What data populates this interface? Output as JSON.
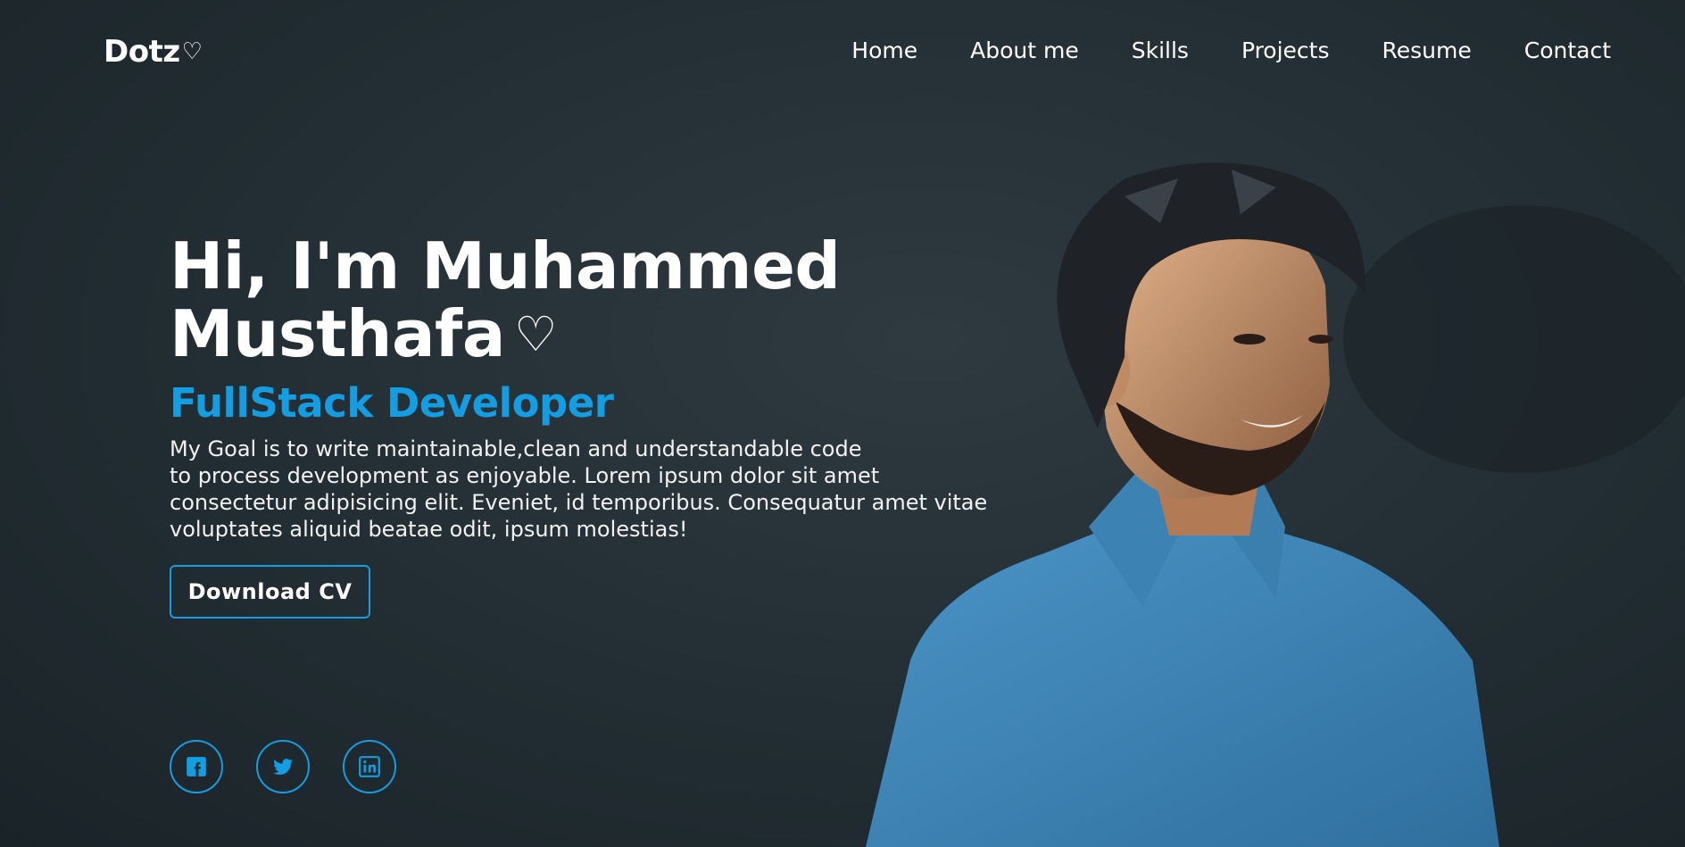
{
  "brand": {
    "name": "Dotz",
    "heart": "♡"
  },
  "nav": {
    "items": [
      {
        "label": "Home"
      },
      {
        "label": "About me"
      },
      {
        "label": "Skills"
      },
      {
        "label": "Projects"
      },
      {
        "label": "Resume"
      },
      {
        "label": "Contact"
      }
    ]
  },
  "hero": {
    "greeting_line1": "Hi, I'm Muhammed",
    "greeting_line2": "Musthafa",
    "heart": "♡",
    "role": "FullStack Developer",
    "description_lines": [
      "My Goal is to write maintainable,clean and understandable code",
      "to process development as enjoyable. Lorem ipsum dolor sit amet",
      "consectetur adipisicing elit. Eveniet, id temporibus. Consequatur amet vitae",
      "voluptates aliquid beatae odit, ipsum molestias!"
    ],
    "cta_label": "Download CV"
  },
  "socials": [
    {
      "icon": "facebook-icon"
    },
    {
      "icon": "twitter-icon"
    },
    {
      "icon": "linkedin-icon"
    }
  ],
  "colors": {
    "accent": "#139ee3",
    "background": "#243036",
    "text": "#ffffff",
    "shirt": "#3f86b8"
  }
}
